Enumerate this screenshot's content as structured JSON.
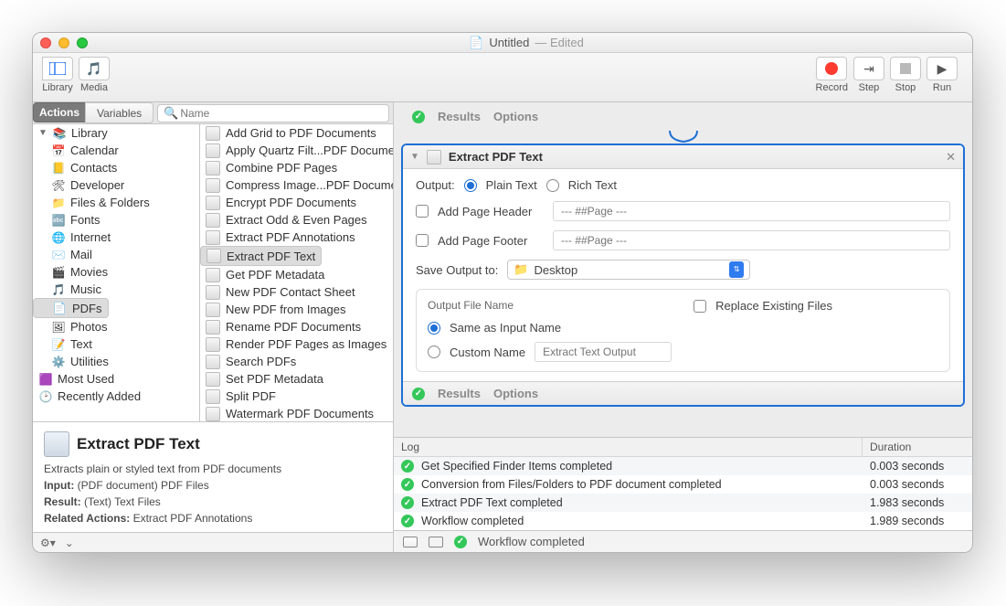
{
  "window": {
    "title": "Untitled",
    "edited": "— Edited"
  },
  "toolbar": {
    "library": "Library",
    "media": "Media",
    "record": "Record",
    "step": "Step",
    "stop": "Stop",
    "run": "Run"
  },
  "libtabs": {
    "actions": "Actions",
    "variables": "Variables",
    "search_placeholder": "Name"
  },
  "tree": {
    "library": "Library",
    "items": [
      "Calendar",
      "Contacts",
      "Developer",
      "Files & Folders",
      "Fonts",
      "Internet",
      "Mail",
      "Movies",
      "Music",
      "PDFs",
      "Photos",
      "Text",
      "Utilities"
    ],
    "most_used": "Most Used",
    "recently_added": "Recently Added"
  },
  "actions": [
    "Add Grid to PDF Documents",
    "Apply Quartz Filt...PDF Documents",
    "Combine PDF Pages",
    "Compress Image...PDF Documents",
    "Encrypt PDF Documents",
    "Extract Odd & Even Pages",
    "Extract PDF Annotations",
    "Extract PDF Text",
    "Get PDF Metadata",
    "New PDF Contact Sheet",
    "New PDF from Images",
    "Rename PDF Documents",
    "Render PDF Pages as Images",
    "Search PDFs",
    "Set PDF Metadata",
    "Split PDF",
    "Watermark PDF Documents"
  ],
  "selected_action_index": 7,
  "info": {
    "title": "Extract PDF Text",
    "desc": "Extracts plain or styled text from PDF documents",
    "input_label": "Input:",
    "input_val": "(PDF document) PDF Files",
    "result_label": "Result:",
    "result_val": "(Text) Text Files",
    "related_label": "Related Actions:",
    "related_val": "Extract PDF Annotations"
  },
  "prev_results": "Results",
  "prev_options": "Options",
  "card": {
    "title": "Extract PDF Text",
    "output_label": "Output:",
    "radio_plain": "Plain Text",
    "radio_rich": "Rich Text",
    "add_header": "Add Page Header",
    "header_ph": "--- ##Page ---",
    "add_footer": "Add Page Footer",
    "footer_ph": "--- ##Page ---",
    "save_label": "Save Output to:",
    "save_loc": "Desktop",
    "ofn_label": "Output File Name",
    "same_name": "Same as Input Name",
    "custom_name": "Custom Name",
    "custom_ph": "Extract Text Output",
    "replace": "Replace Existing Files",
    "foot_results": "Results",
    "foot_options": "Options"
  },
  "log": {
    "h1": "Log",
    "h2": "Duration",
    "rows": [
      {
        "msg": "Get Specified Finder Items completed",
        "dur": "0.003 seconds"
      },
      {
        "msg": "Conversion from Files/Folders to PDF document completed",
        "dur": "0.003 seconds"
      },
      {
        "msg": "Extract PDF Text completed",
        "dur": "1.983 seconds"
      },
      {
        "msg": "Workflow completed",
        "dur": "1.989 seconds"
      }
    ]
  },
  "status": "Workflow completed"
}
